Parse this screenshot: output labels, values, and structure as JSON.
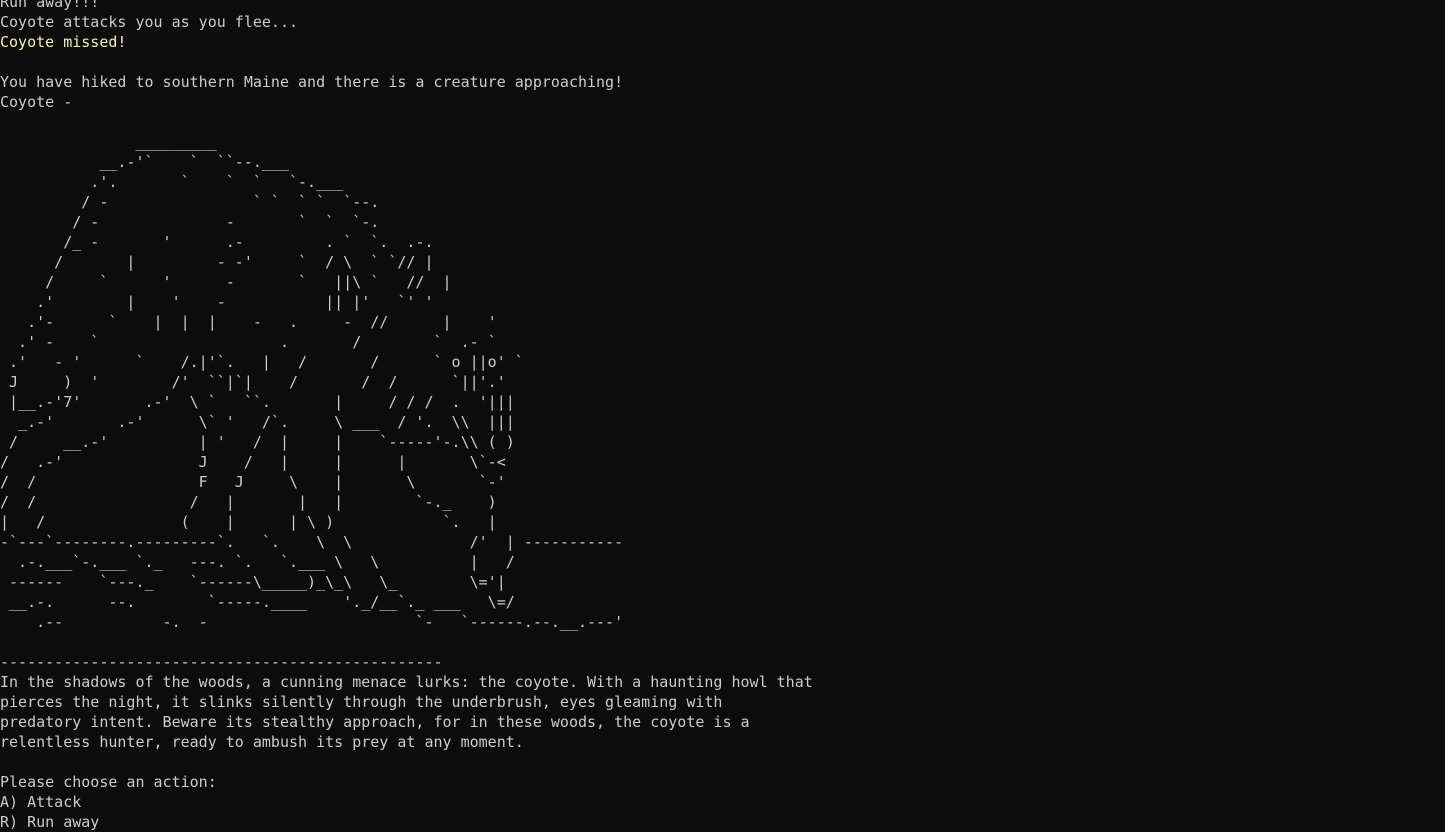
{
  "terminal": {
    "background": "#0c0c0c",
    "foreground": "#cccccc",
    "highlight": "#f9f1a5",
    "log": {
      "run_away": "Run away!!!",
      "flee_attack": "Coyote attacks you as you flee...",
      "missed": "Coyote missed!"
    },
    "encounter": {
      "location": "You have hiked to southern Maine and there is a creature approaching!",
      "creature": "Coyote -"
    },
    "art": "               _________\n           __.-'`    `  ``--.___\n          .'.       `    `  `   `-.___\n         / -                ` `  ` `  `--.\n        / -              -       `  `  `-.\n       /_ -       '      .-         . `  `.  .-.\n      /       |         - -'     `  / \\  ` `// |\n     /     `      '      -       `   ||\\ `   //  |\n    .'        |    '    -           || |'   `' '\n   .'-      `    |  |  |    -   .     -  //      |    '\n  .' -    `                    .       /        `  .- `\n .'   - '      `    /.|'`.   |   /       /      ` o ||o' `\n J     )  '        /'  ``|`|    /       /  /      `||'.'\n |__.-'7'       .-'  \\ `   ``.       |     / / /  .  '|||\n  _.-'       .-'      \\` '   /`.     \\ ___  / '.  \\\\  |||\n /     __.-'          | '   /  |     |    `-----'-.\\\\ ( )\n/   .-'               J    /   |     |      |       \\`-<\n/  /                  F   J     \\    |       \\       `-'\n/  /                 /   |       |   |        `-._    )\n|   /               (    |      | \\ )            `.   |\n-`---`--------.---------`.   `.    \\  \\             /'  | -----------\n  .-.___`-.___ `._   ---. `.   `.___ \\   \\          |   /\n ------    `---._    `------\\_____)_\\_\\   \\_        \\='|\n __.-.      --.        `-----.____    '._/__`._ ___   \\=/\n    .--           -.  -                       `-   `------.--.__.---'",
    "separator": "-------------------------------------------------",
    "description": [
      "In the shadows of the woods, a cunning menace lurks: the coyote. With a haunting howl that",
      "pierces the night, it slinks silently through the underbrush, eyes gleaming with",
      "predatory intent. Beware its stealthy approach, for in these woods, the coyote is a",
      "relentless hunter, ready to ambush its prey at any moment."
    ],
    "prompt": "Please choose an action:",
    "options": [
      "A) Attack",
      "R) Run away"
    ]
  }
}
